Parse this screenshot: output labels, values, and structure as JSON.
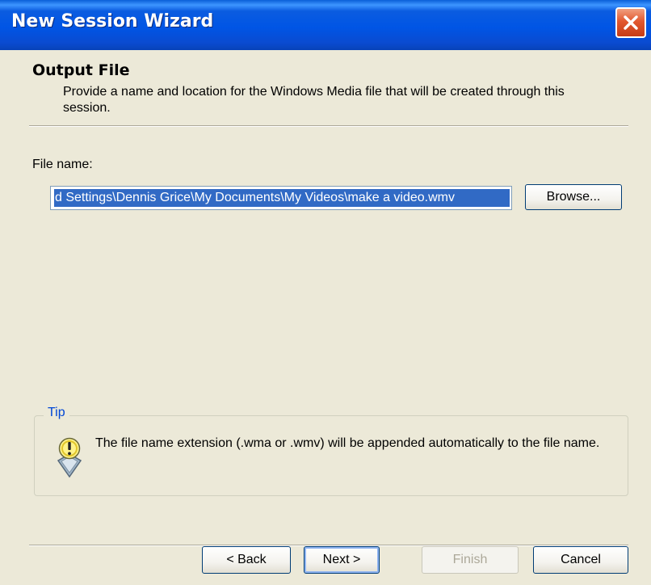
{
  "window": {
    "title": "New Session Wizard",
    "close_icon": "close-icon"
  },
  "header": {
    "title": "Output File",
    "description": "Provide a name and location for the Windows Media file that will be created through this session."
  },
  "form": {
    "file_name_label": "File name:",
    "file_name_value": "d Settings\\Dennis Grice\\My Documents\\My Videos\\make a video.wmv",
    "browse_label": "Browse..."
  },
  "tip": {
    "title": "Tip",
    "icon": "tip-icon",
    "text": "The file name extension (.wma or .wmv) will be appended automatically to the file name."
  },
  "footer": {
    "back_label": "< Back",
    "next_label": "Next >",
    "finish_label": "Finish",
    "cancel_label": "Cancel"
  },
  "colors": {
    "title_bar": "#0055e5",
    "selection": "#316ac5",
    "tip_title": "#0046d5",
    "dialog_bg": "#ece9d8"
  }
}
